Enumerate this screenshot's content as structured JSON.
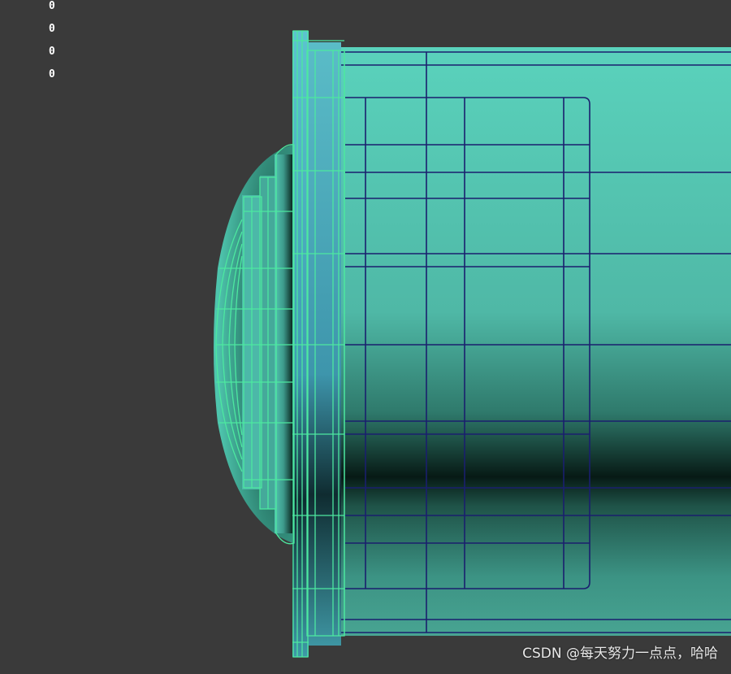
{
  "viewport": {
    "hud_values": [
      "0",
      "0",
      "0",
      "0"
    ]
  },
  "watermark": {
    "text": "CSDN @每天努力一点点，哈哈"
  },
  "colors": {
    "background": "#3a3a3a",
    "mesh_face": "#56cbb6",
    "wireframe_selected": "#4de8a0",
    "wireframe_edges": "#1a1f6e"
  }
}
